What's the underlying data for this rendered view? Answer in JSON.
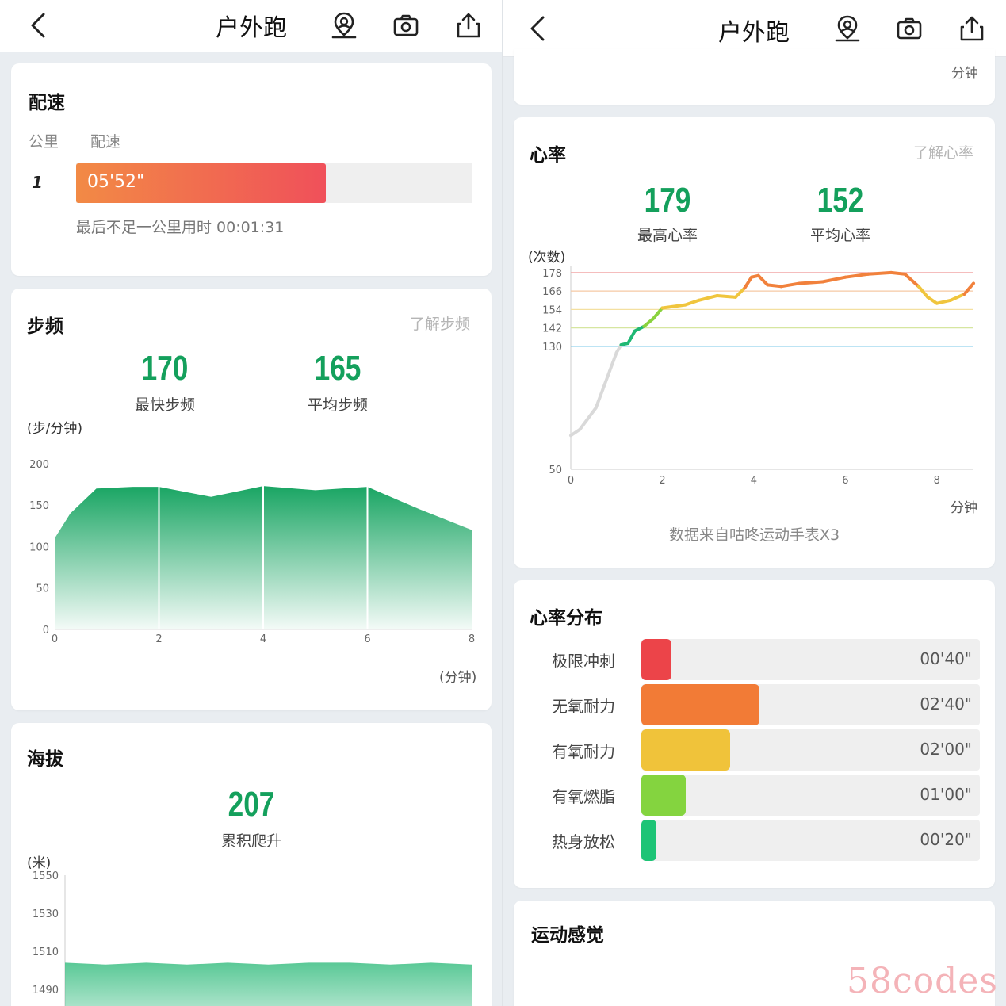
{
  "header": {
    "title": "户外跑"
  },
  "pace_card": {
    "title": "配速",
    "col_km": "公里",
    "col_pace": "配速",
    "rows": [
      {
        "km": "1",
        "pace": "05'52\"",
        "fraction": 0.63
      }
    ],
    "last_note": "最后不足一公里用时 00:01:31",
    "bar_gradient": [
      "#f28a45",
      "#f0505a"
    ]
  },
  "cadence_card": {
    "title": "步频",
    "link": "了解步频",
    "max_value": "170",
    "max_label": "最快步频",
    "avg_value": "165",
    "avg_label": "平均步频",
    "y_unit": "(步/分钟)",
    "x_unit": "(分钟)"
  },
  "altitude_card": {
    "title": "海拔",
    "climb_value": "207",
    "climb_label": "累积爬升",
    "y_unit": "(米)"
  },
  "top_stub": {
    "unit": "分钟"
  },
  "heart_card": {
    "title": "心率",
    "link": "了解心率",
    "max_value": "179",
    "max_label": "最高心率",
    "avg_value": "152",
    "avg_label": "平均心率",
    "y_unit": "(次数)",
    "x_unit": "分钟",
    "source": "数据来自咕咚运动手表X3"
  },
  "zone_card": {
    "title": "心率分布",
    "zones": [
      {
        "label": "极限冲刺",
        "time": "00'40\"",
        "fraction": 0.088,
        "color": "#ec4449"
      },
      {
        "label": "无氧耐力",
        "time": "02'40\"",
        "fraction": 0.35,
        "color": "#f27b36"
      },
      {
        "label": "有氧耐力",
        "time": "02'00\"",
        "fraction": 0.262,
        "color": "#f0c33a"
      },
      {
        "label": "有氧燃脂",
        "time": "01'00\"",
        "fraction": 0.131,
        "color": "#84d43f"
      },
      {
        "label": "热身放松",
        "time": "00'20\"",
        "fraction": 0.044,
        "color": "#1dc476"
      }
    ]
  },
  "feeling_card": {
    "title": "运动感觉"
  },
  "watermark": "58codes",
  "chart_data": [
    {
      "type": "area",
      "title": "步频",
      "ylabel": "(步/分钟)",
      "xlabel": "(分钟)",
      "x": [
        0,
        0.3,
        0.8,
        1.5,
        2,
        3,
        4,
        5,
        6,
        7,
        8
      ],
      "values": [
        110,
        140,
        170,
        172,
        172,
        160,
        173,
        168,
        172,
        145,
        120
      ],
      "xlim": [
        0,
        8
      ],
      "ylim": [
        0,
        220
      ],
      "xticks": [
        0,
        2,
        4,
        6,
        8
      ],
      "yticks": [
        0,
        50,
        100,
        150,
        200
      ],
      "color": "#19a563"
    },
    {
      "type": "line",
      "title": "心率",
      "ylabel": "(次数)",
      "xlabel": "分钟",
      "x": [
        0,
        0.2,
        0.35,
        0.55,
        0.7,
        0.85,
        1.0,
        1.1,
        1.25,
        1.4,
        1.6,
        1.8,
        2.0,
        2.5,
        2.8,
        3.2,
        3.6,
        3.8,
        3.95,
        4.1,
        4.3,
        4.6,
        5.0,
        5.5,
        6.0,
        6.5,
        7.0,
        7.3,
        7.6,
        7.8,
        8.0,
        8.3,
        8.6,
        8.8
      ],
      "values": [
        72,
        76,
        82,
        90,
        102,
        114,
        126,
        131,
        132,
        140,
        143,
        148,
        155,
        157,
        160,
        163,
        162,
        168,
        175,
        176,
        170,
        169,
        171,
        172,
        175,
        177,
        178,
        177,
        169,
        162,
        158,
        160,
        164,
        171
      ],
      "xlim": [
        0,
        8.8
      ],
      "ylim": [
        50,
        180
      ],
      "xticks": [
        0,
        2,
        4,
        6,
        8
      ],
      "yticks": [
        50,
        130,
        142,
        154,
        166,
        178
      ],
      "zone_lines": [
        {
          "value": 130,
          "color": "#7bc8e8"
        },
        {
          "value": 142,
          "color": "#d6e6a0"
        },
        {
          "value": 154,
          "color": "#f4e0a0"
        },
        {
          "value": 166,
          "color": "#f6c9a4"
        },
        {
          "value": 178,
          "color": "#f2a7a7"
        }
      ]
    },
    {
      "type": "area",
      "title": "海拔",
      "ylabel": "(米)",
      "x": [
        0,
        1,
        2,
        3,
        4,
        5,
        6,
        7,
        8,
        9,
        10
      ],
      "values": [
        1504,
        1503,
        1504,
        1503,
        1504,
        1503,
        1504,
        1504,
        1503,
        1504,
        1503
      ],
      "ylim": [
        1480,
        1560
      ],
      "yticks": [
        1490,
        1510,
        1530,
        1550
      ],
      "color": "#3dbf84"
    }
  ]
}
